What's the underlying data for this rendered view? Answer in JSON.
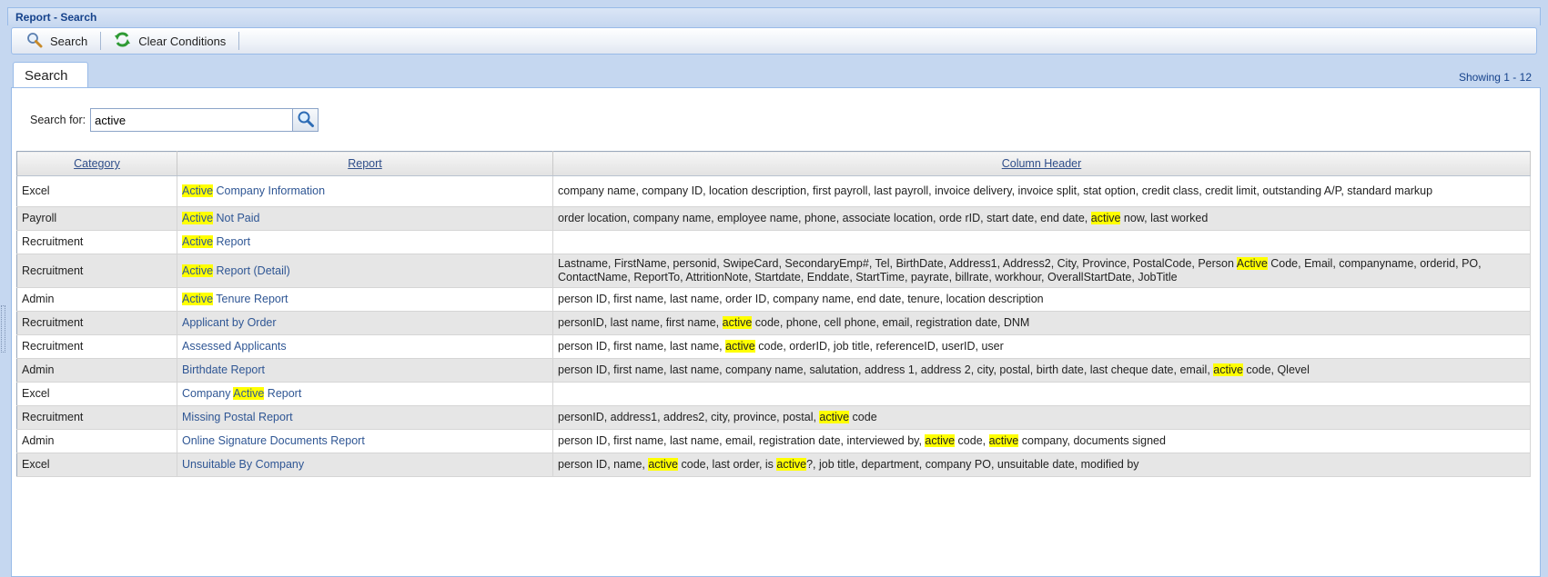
{
  "window": {
    "title": "Report - Search"
  },
  "toolbar": {
    "search_label": "Search",
    "clear_label": "Clear Conditions",
    "search_icon": "magnifier-icon",
    "clear_icon": "refresh-icon"
  },
  "tabs": [
    {
      "label": "Search",
      "active": true
    }
  ],
  "status": {
    "showing": "Showing 1 - 12"
  },
  "search": {
    "label": "Search for:",
    "value": "active",
    "button_icon": "magnifier-icon"
  },
  "highlight_color": "#ffff00",
  "grid": {
    "columns": [
      "Category",
      "Report",
      "Column Header"
    ],
    "rows": [
      {
        "category": "Excel",
        "report": "Active Company Information",
        "columns": "company name, company ID, location description, first payroll, last payroll, invoice delivery, invoice split, stat option, credit class, credit limit, outstanding A/P, standard markup"
      },
      {
        "category": "Payroll",
        "report": "Active Not Paid",
        "columns": "order location, company name, employee name, phone, associate location, orde rID, start date, end date, active now, last worked"
      },
      {
        "category": "Recruitment",
        "report": "Active Report",
        "columns": ""
      },
      {
        "category": "Recruitment",
        "report": "Active Report (Detail)",
        "columns": "Lastname, FirstName, personid, SwipeCard, SecondaryEmp#, Tel, BirthDate, Address1, Address2, City, Province, PostalCode, Person Active Code, Email, companyname, orderid, PO, ContactName, ReportTo, AttritionNote, Startdate, Enddate, StartTime, payrate, billrate, workhour, OverallStartDate, JobTitle"
      },
      {
        "category": "Admin",
        "report": "Active Tenure Report",
        "columns": "person ID, first name, last name, order ID, company name, end date, tenure, location description"
      },
      {
        "category": "Recruitment",
        "report": "Applicant by Order",
        "columns": "personID, last name, first name, active code, phone, cell phone, email, registration date, DNM"
      },
      {
        "category": "Recruitment",
        "report": "Assessed Applicants",
        "columns": "person ID, first name, last name, active code, orderID, job title, referenceID, userID, user"
      },
      {
        "category": "Admin",
        "report": "Birthdate Report",
        "columns": "person ID, first name, last name, company name, salutation, address 1, address 2, city, postal, birth date, last cheque date, email, active code, Qlevel"
      },
      {
        "category": "Excel",
        "report": "Company Active Report",
        "columns": ""
      },
      {
        "category": "Recruitment",
        "report": "Missing Postal Report",
        "columns": "personID, address1, addres2, city, province, postal, active code"
      },
      {
        "category": "Admin",
        "report": "Online Signature Documents Report",
        "columns": "person ID, first name, last name, email, registration date, interviewed by, active code, active company, documents signed"
      },
      {
        "category": "Excel",
        "report": "Unsuitable By Company",
        "columns": "person ID, name, active code, last order, is active?, job title, department, company PO, unsuitable date, modified by"
      }
    ]
  }
}
